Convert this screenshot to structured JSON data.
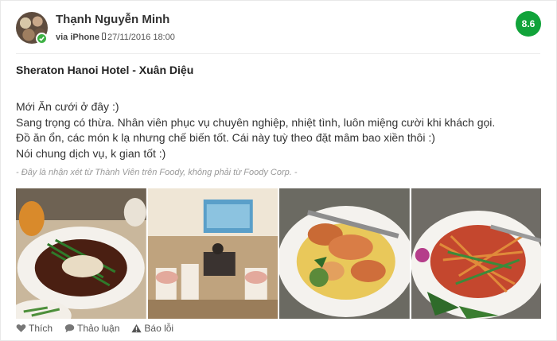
{
  "review": {
    "user_name": "Thạnh Nguyễn Minh",
    "via_device": "via iPhone",
    "date": "27/11/2016 18:00",
    "score": "8.6",
    "place_title": "Sheraton Hanoi Hotel - Xuân Diệu",
    "body_lines": [
      "Mới Ăn cưới ở đây :)",
      "Sang trọng có thừa. Nhân viên phục vụ chuyên nghiệp, nhiệt tình, luôn miệng cười khi khách gọi.",
      "Đồ ăn ổn, các món k lạ nhưng chế biến tốt. Cái này tuỳ theo đặt mâm bao xiền thôi :)",
      "Nói chung dịch vụ, k gian tốt :)"
    ],
    "disclaimer": "- Đây là nhận xét từ Thành Viên trên Foody, không phải từ Foody Corp. -"
  },
  "photos": [
    {
      "name": "photo-fish-dish"
    },
    {
      "name": "photo-wedding-hall"
    },
    {
      "name": "photo-prawn-dish"
    },
    {
      "name": "photo-salad-dish"
    }
  ],
  "actions": {
    "like_label": "Thích",
    "discuss_label": "Thảo luận",
    "report_label": "Báo lỗi"
  },
  "colors": {
    "score_badge": "#11a33a",
    "verified_badge": "#3cb043",
    "disclaimer_text": "#999999"
  },
  "icons": [
    "verified-check-icon",
    "phone-icon",
    "heart-icon",
    "comment-icon",
    "warning-icon"
  ]
}
